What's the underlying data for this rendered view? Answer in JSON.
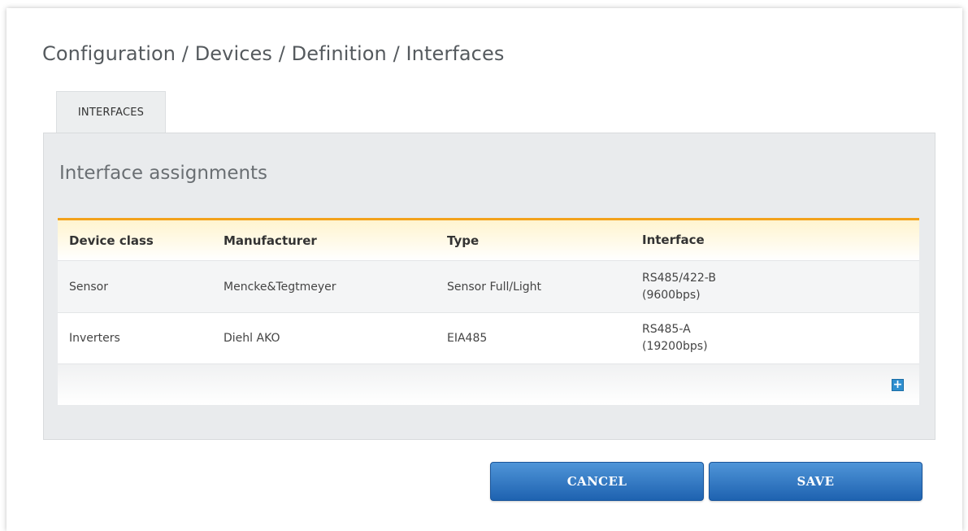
{
  "breadcrumb": "Configuration / Devices / Definition / Interfaces",
  "tabs": [
    {
      "label": "INTERFACES"
    }
  ],
  "section_title": "Interface assignments",
  "table": {
    "headers": [
      "Device class",
      "Manufacturer",
      "Type",
      "Interface"
    ],
    "rows": [
      {
        "device_class": "Sensor",
        "manufacturer": "Mencke&Tegtmeyer",
        "type": "Sensor Full/Light",
        "interface_line1": "RS485/422-B",
        "interface_line2": "(9600bps)"
      },
      {
        "device_class": "Inverters",
        "manufacturer": "Diehl AKO",
        "type": "EIA485",
        "interface_line1": "RS485-A",
        "interface_line2": "(19200bps)"
      }
    ],
    "add_icon": "plus-icon",
    "add_symbol": "+"
  },
  "buttons": {
    "cancel": "CANCEL",
    "save": "SAVE"
  },
  "colors": {
    "accent_orange": "#f3a21c",
    "button_blue": "#2a6fbe",
    "panel_bg": "#e9ebed"
  }
}
